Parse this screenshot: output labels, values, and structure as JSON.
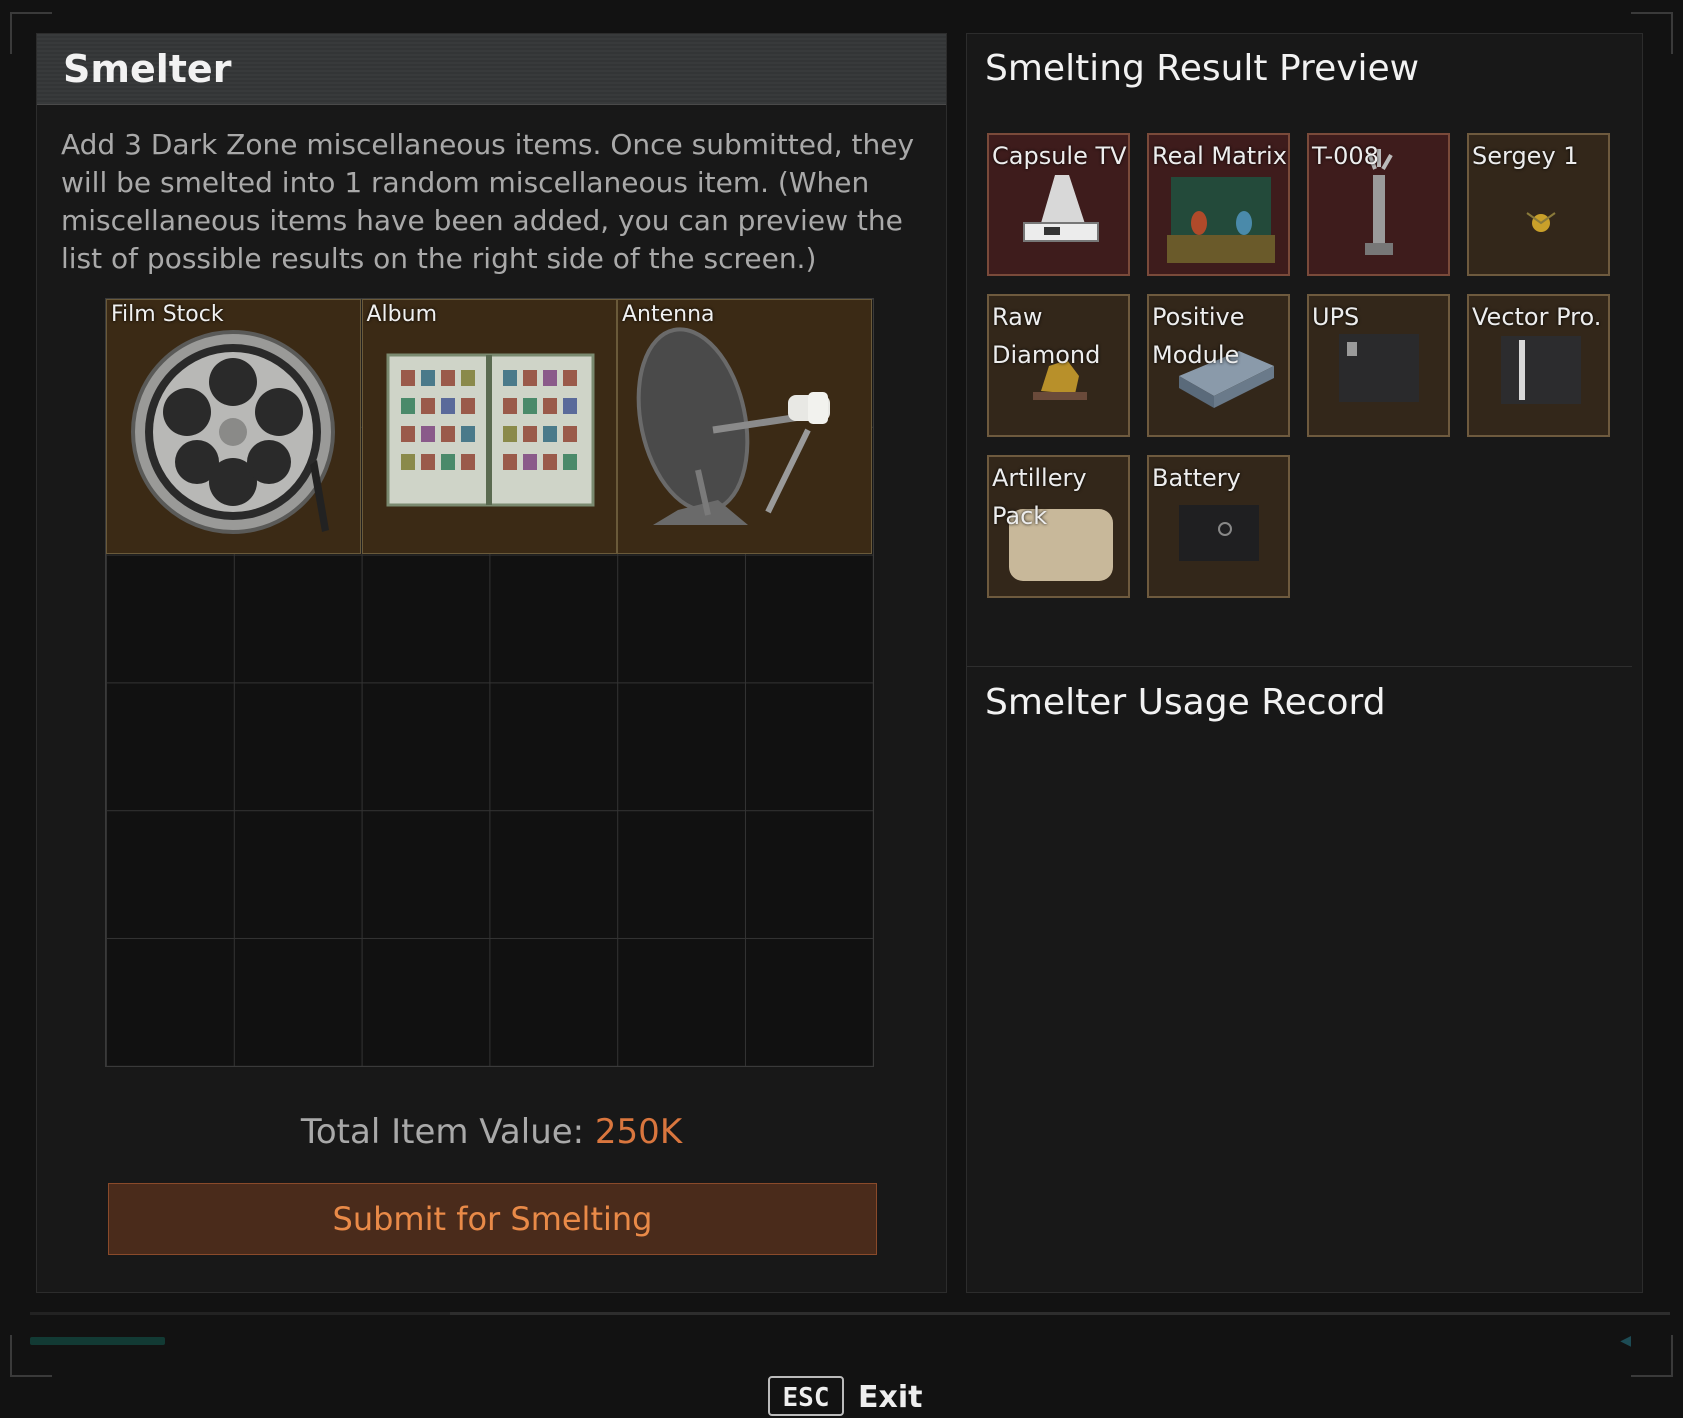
{
  "left_panel": {
    "title": "Smelter",
    "description": "Add 3 Dark Zone miscellaneous items. Once submitted, they will be smelted into 1 random miscellaneous item. (When miscellaneous items have been added, you can preview the list of possible results on the right side of the screen.)",
    "items": [
      {
        "label": "Film Stock",
        "icon": "film-reel-icon"
      },
      {
        "label": "Album",
        "icon": "stamp-album-icon"
      },
      {
        "label": "Antenna",
        "icon": "satellite-dish-icon"
      }
    ],
    "total_label": "Total Item Value: ",
    "total_value": "250K",
    "submit_label": "Submit for Smelting"
  },
  "right_panel": {
    "preview_title": "Smelting Result Preview",
    "results": [
      {
        "label": "Capsule TV",
        "tier": "red",
        "icon": "capsule-tv-icon"
      },
      {
        "label": "Real Matrix",
        "tier": "red",
        "icon": "matrix-case-icon"
      },
      {
        "label": "T-008",
        "tier": "red",
        "icon": "robot-arm-icon"
      },
      {
        "label": "Sergey 1",
        "tier": "brown",
        "icon": "sergey-pendant-icon"
      },
      {
        "label": "Raw Diamond",
        "tier": "brown",
        "icon": "raw-diamond-icon"
      },
      {
        "label": "Positive Module",
        "tier": "brown",
        "icon": "module-icon"
      },
      {
        "label": "UPS",
        "tier": "brown",
        "icon": "ups-box-icon"
      },
      {
        "label": "Vector Pro.",
        "tier": "brown",
        "icon": "vector-processor-icon"
      },
      {
        "label": "Artillery Pack",
        "tier": "brown",
        "icon": "artillery-pack-icon"
      },
      {
        "label": "Battery",
        "tier": "brown",
        "icon": "battery-box-icon"
      }
    ],
    "usage_title": "Smelter Usage Record"
  },
  "footer": {
    "key": "ESC",
    "action": "Exit"
  },
  "colors": {
    "accent_orange": "#d9763e",
    "red_tier": "#3e1c1c",
    "brown_tier": "#33271a"
  }
}
